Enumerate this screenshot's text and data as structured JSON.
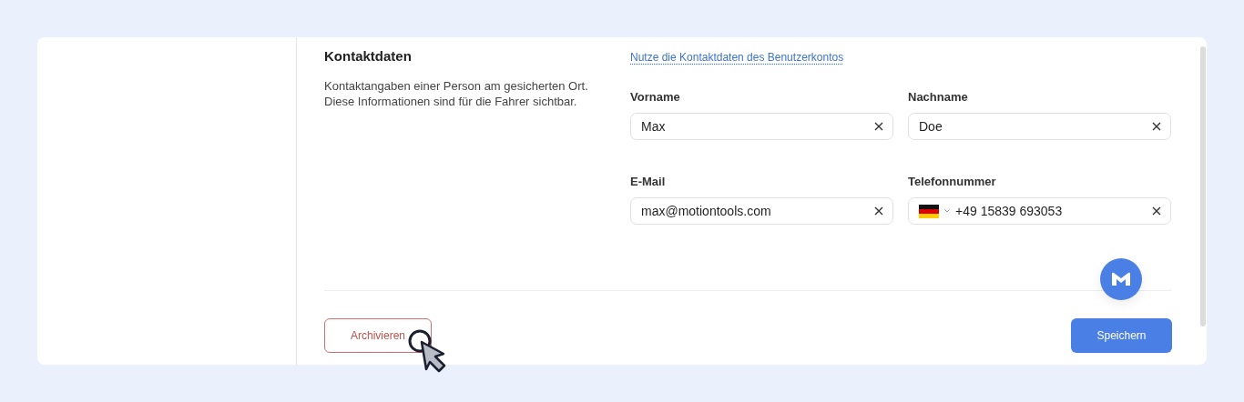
{
  "section": {
    "title": "Kontaktdaten",
    "description": "Kontaktangaben einer Person am gesicherten Ort.\nDiese Informationen sind für die Fahrer sichtbar."
  },
  "account_link": "Nutze die Kontaktdaten des Benutzerkontos",
  "fields": [
    {
      "kind": "text",
      "label": "Vorname",
      "value": "Max"
    },
    {
      "kind": "text",
      "label": "Nachname",
      "value": "Doe"
    },
    {
      "kind": "text",
      "label": "E-Mail",
      "value": "max@motiontools.com"
    },
    {
      "kind": "phone",
      "label": "Telefonnummer",
      "value": "+49 15839 693053"
    }
  ],
  "buttons": [
    {
      "kind": "outline",
      "label": "Archivieren"
    },
    {
      "kind": "primary",
      "label": "Speichern"
    }
  ]
}
